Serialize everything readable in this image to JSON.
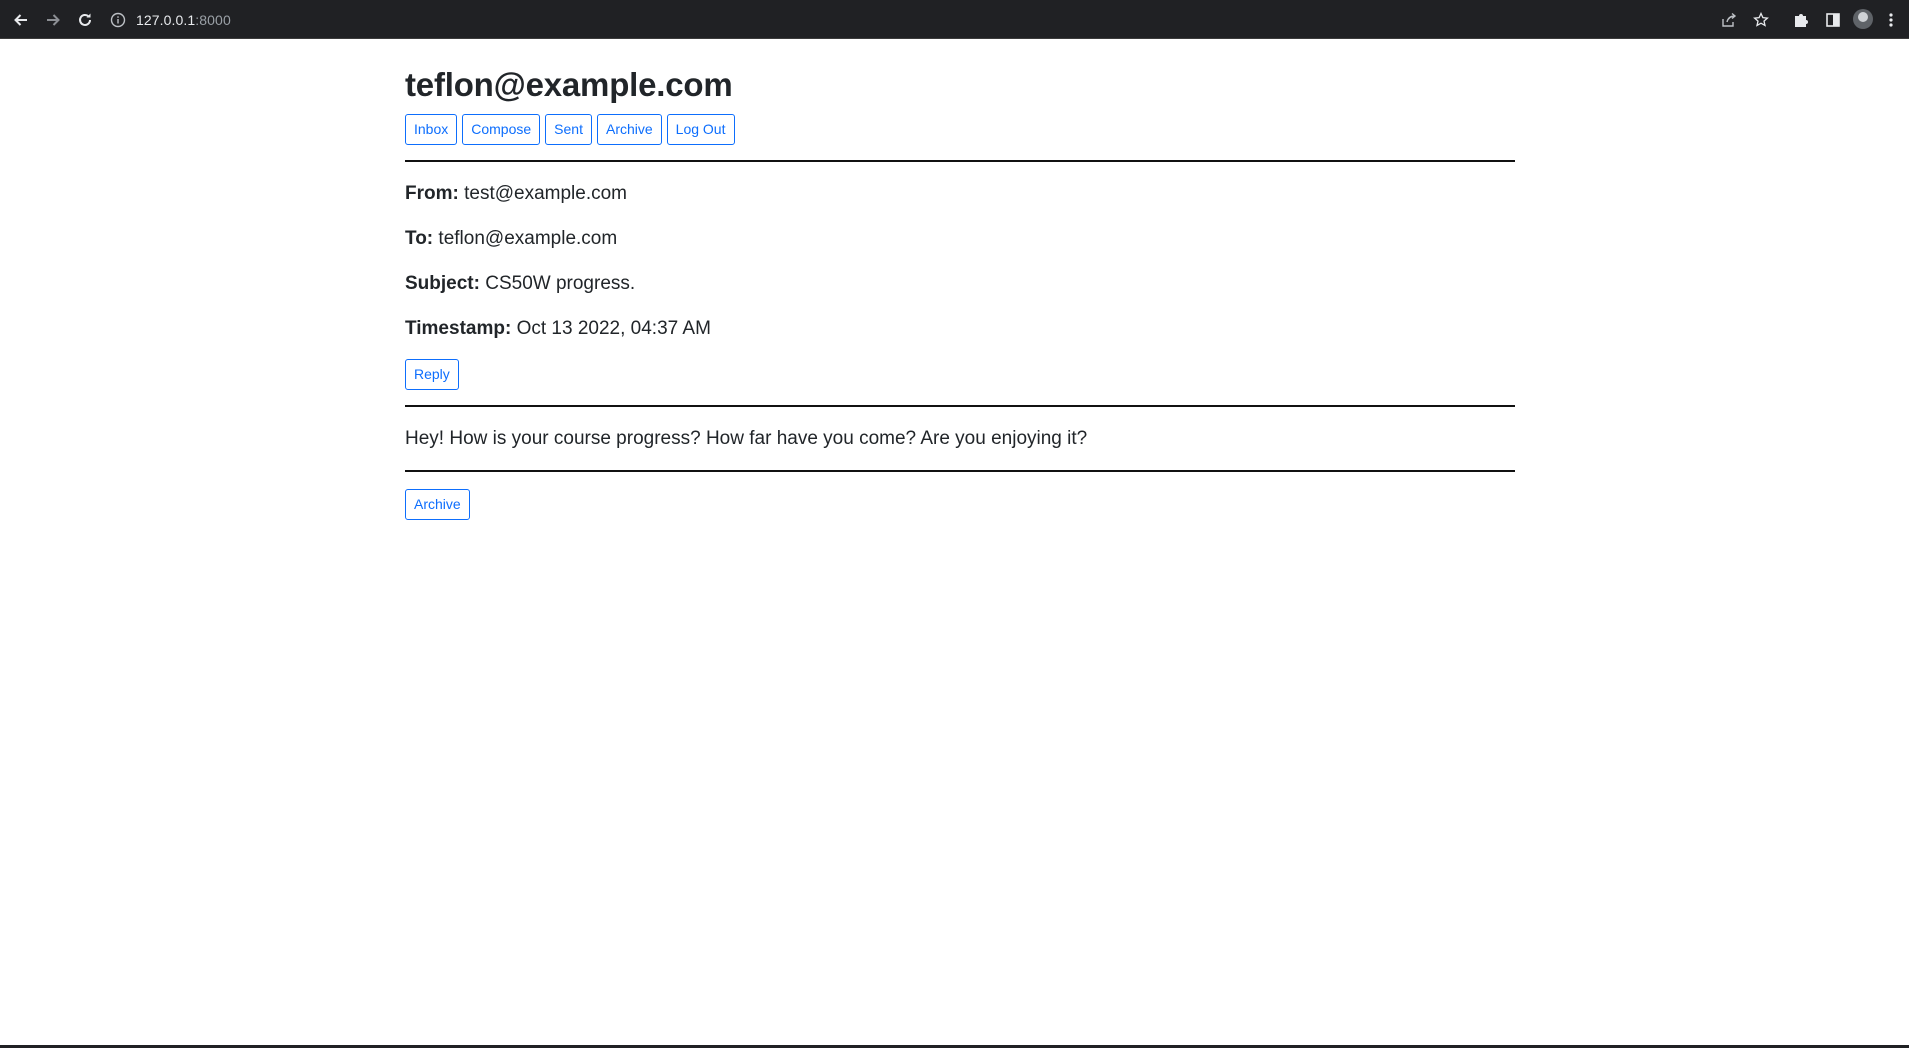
{
  "browser": {
    "url_host": "127.0.0.1",
    "url_port": ":8000"
  },
  "header": {
    "user_email": "teflon@example.com",
    "nav": [
      "Inbox",
      "Compose",
      "Sent",
      "Archive",
      "Log Out"
    ]
  },
  "email": {
    "from_label": "From:",
    "from_value": "test@example.com",
    "to_label": "To:",
    "to_value": "teflon@example.com",
    "subject_label": "Subject:",
    "subject_value": "CS50W progress.",
    "timestamp_label": "Timestamp:",
    "timestamp_value": "Oct 13 2022, 04:37 AM",
    "reply_label": "Reply",
    "body": "Hey! How is your course progress? How far have you come? Are you enjoying it?",
    "archive_label": "Archive"
  },
  "colors": {
    "chrome_bg": "#202124",
    "link_blue": "#0d6efd",
    "text": "#212529"
  }
}
